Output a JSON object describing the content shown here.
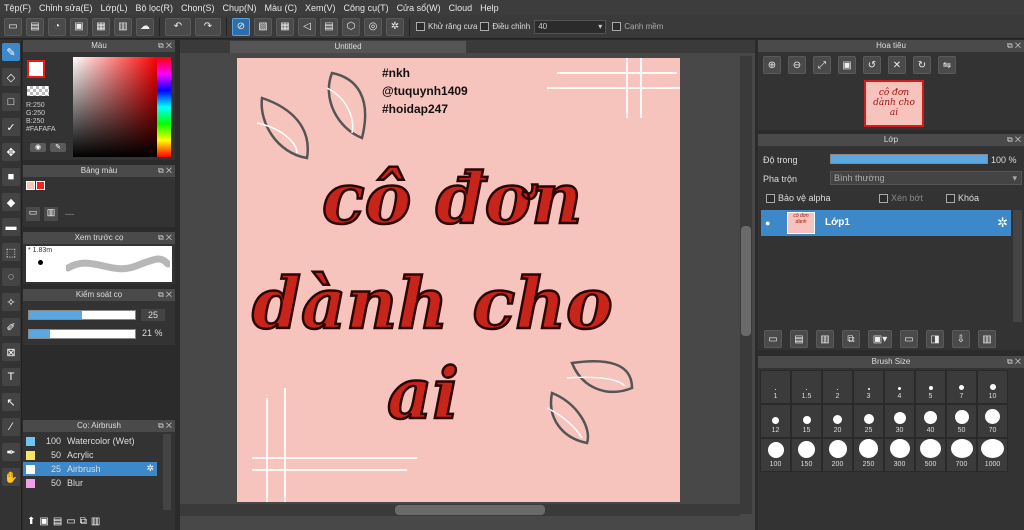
{
  "menu": [
    "Tệp(F)",
    "Chỉnh sửa(E)",
    "Lớp(L)",
    "Bộ lọc(R)",
    "Chọn(S)",
    "Chụp(N)",
    "Màu (C)",
    "Xem(V)",
    "Công cụ(T)",
    "Cửa sổ(W)",
    "Cloud",
    "Help"
  ],
  "toolbar": {
    "antialias_label": "Khử răng cưa",
    "adjust_label": "Điều chỉnh",
    "adjust_value": "40",
    "soft_edge_label": "Cạnh mềm"
  },
  "color_panel": {
    "title": "Màu",
    "r": "R:250",
    "g": "G:250",
    "b": "B:250",
    "hex": "#FAFAFA"
  },
  "palette_panel": {
    "title": "Bảng màu",
    "dash": "---"
  },
  "brush_preview": {
    "title": "Xem trước cọ",
    "size": "* 1.83m"
  },
  "brush_control": {
    "title": "Kiểm soát cọ",
    "size": "25",
    "opacity": "21 %",
    "size_level": 0.5,
    "opacity_level": 0.2
  },
  "brush_list": {
    "title": "Cọ: Airbrush",
    "items": [
      {
        "num": "100",
        "name": "Watercolor (Wet)",
        "color": "#6ec6f0"
      },
      {
        "num": "50",
        "name": "Acrylic",
        "color": "#f5e36a"
      },
      {
        "num": "25",
        "name": "Airbrush",
        "color": "#ffffff",
        "selected": true
      },
      {
        "num": "50",
        "name": "Blur",
        "color": "#f0a0e8"
      }
    ]
  },
  "document": {
    "tab": "Untitled",
    "tags": [
      "#nkh",
      "@tuquynh1409",
      "#hoidap247"
    ]
  },
  "navigator": {
    "title": "Hoa tiêu"
  },
  "layer_panel": {
    "title": "Lớp",
    "opacity_label": "Độ trong",
    "opacity_value": "100 %",
    "blend_label": "Pha trộn",
    "blend_value": "Bình thường",
    "protect_alpha": "Bảo vệ alpha",
    "clipping": "Xén bớt",
    "lock": "Khóa",
    "layer_name": "Lớp1"
  },
  "brush_size": {
    "title": "Brush Size",
    "rows": [
      [
        "1",
        "1.5",
        "2",
        "3",
        "4",
        "5",
        "7",
        "10"
      ],
      [
        "12",
        "15",
        "20",
        "25",
        "30",
        "40",
        "50",
        "70"
      ],
      [
        "100",
        "150",
        "200",
        "250",
        "300",
        "500",
        "700",
        "1000"
      ]
    ]
  },
  "colors": {
    "accent": "#3c88c8",
    "canvas": "#f7c4bd",
    "ink": "#e8281a"
  }
}
